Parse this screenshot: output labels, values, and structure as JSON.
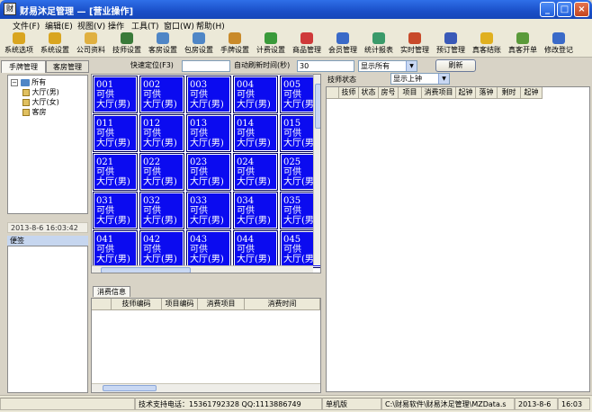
{
  "window": {
    "title": "财易沐足管理 — [营业操作]",
    "buttons": [
      "_",
      "□",
      "×"
    ]
  },
  "menu": [
    "文件(F)",
    "编辑(E)",
    "视图(V)",
    "操作",
    "工具(T)",
    "窗口(W)",
    "帮助(H)"
  ],
  "toolbar": [
    {
      "label": "系统选项",
      "icon": "system-options-icon",
      "color": "#d9a520"
    },
    {
      "label": "系统设置",
      "icon": "system-settings-icon",
      "color": "#d9a520"
    },
    {
      "label": "公司资料",
      "icon": "company-info-icon",
      "color": "#e0b040"
    },
    {
      "label": "技师设置",
      "icon": "technician-settings-icon",
      "color": "#3a7a3a"
    },
    {
      "label": "客房设置",
      "icon": "room-settings-icon",
      "color": "#4f86c6"
    },
    {
      "label": "包房设置",
      "icon": "private-room-settings-icon",
      "color": "#4f86c6"
    },
    {
      "label": "手牌设置",
      "icon": "hand-card-settings-icon",
      "color": "#c98a2a"
    },
    {
      "label": "计费设置",
      "icon": "billing-settings-icon",
      "color": "#3a9a3a"
    },
    {
      "label": "商品管理",
      "icon": "product-management-icon",
      "color": "#cf3a3a"
    },
    {
      "label": "会员管理",
      "icon": "member-management-icon",
      "color": "#3a6ac8"
    },
    {
      "label": "统计报表",
      "icon": "statistics-report-icon",
      "color": "#3a9a6a"
    },
    {
      "label": "实时管理",
      "icon": "realtime-management-icon",
      "color": "#c84a2a"
    },
    {
      "label": "预订管理",
      "icon": "reservation-management-icon",
      "color": "#3a5ab8"
    },
    {
      "label": "真客结账",
      "icon": "checkout-icon",
      "color": "#e0b020"
    },
    {
      "label": "真客开单",
      "icon": "open-order-icon",
      "color": "#5a9a3a"
    },
    {
      "label": "修改登记",
      "icon": "modify-registration-icon",
      "color": "#3a6ac8"
    }
  ],
  "left_panel": {
    "tabs": [
      "手牌管理",
      "客房管理"
    ],
    "tree": {
      "root": "所有",
      "children": [
        "大厅(男)",
        "大厅(女)",
        "客房"
      ]
    },
    "datetime": "2013-8-6  16:03:42",
    "note_label": "便签"
  },
  "center_controls": {
    "quick_locate_label": "快速定位(F3)",
    "quick_locate_value": "",
    "auto_refresh_label": "自动刷新时间(秒)",
    "auto_refresh_value": "30",
    "display_select": "显示所有",
    "refresh_button": "刷新"
  },
  "rooms": [
    {
      "number": "001",
      "status": "可供",
      "type": "大厅(男)"
    },
    {
      "number": "002",
      "status": "可供",
      "type": "大厅(男)"
    },
    {
      "number": "003",
      "status": "可供",
      "type": "大厅(男)"
    },
    {
      "number": "004",
      "status": "可供",
      "type": "大厅(男)"
    },
    {
      "number": "005",
      "status": "可供",
      "type": "大厅(男)"
    },
    {
      "number": "011",
      "status": "可供",
      "type": "大厅(男)"
    },
    {
      "number": "012",
      "status": "可供",
      "type": "大厅(男)"
    },
    {
      "number": "013",
      "status": "可供",
      "type": "大厅(男)"
    },
    {
      "number": "014",
      "status": "可供",
      "type": "大厅(男)"
    },
    {
      "number": "015",
      "status": "可供",
      "type": "大厅(男)"
    },
    {
      "number": "021",
      "status": "可供",
      "type": "大厅(男)"
    },
    {
      "number": "022",
      "status": "可供",
      "type": "大厅(男)"
    },
    {
      "number": "023",
      "status": "可供",
      "type": "大厅(男)"
    },
    {
      "number": "024",
      "status": "可供",
      "type": "大厅(男)"
    },
    {
      "number": "025",
      "status": "可供",
      "type": "大厅(男)"
    },
    {
      "number": "031",
      "status": "可供",
      "type": "大厅(男)"
    },
    {
      "number": "032",
      "status": "可供",
      "type": "大厅(男)"
    },
    {
      "number": "033",
      "status": "可供",
      "type": "大厅(男)"
    },
    {
      "number": "034",
      "status": "可供",
      "type": "大厅(男)"
    },
    {
      "number": "035",
      "status": "可供",
      "type": "大厅(男)"
    },
    {
      "number": "041",
      "status": "可供",
      "type": "大厅(男)"
    },
    {
      "number": "042",
      "status": "可供",
      "type": "大厅(男)"
    },
    {
      "number": "043",
      "status": "可供",
      "type": "大厅(男)"
    },
    {
      "number": "044",
      "status": "可供",
      "type": "大厅(男)"
    },
    {
      "number": "045",
      "status": "可供",
      "type": "大厅(男)"
    }
  ],
  "room_color": "#0b0bf0",
  "consume_panel": {
    "tab": "消费信息",
    "columns": [
      "",
      "技师编码",
      "项目编码",
      "消费项目",
      "消费时间"
    ]
  },
  "tech_panel": {
    "status_label": "技师状态",
    "status_select": "显示上钟",
    "columns": [
      "",
      "技师",
      "状态",
      "房号",
      "项目",
      "消费项目",
      "起钟",
      "落钟",
      "剩时",
      "起钟"
    ]
  },
  "statusbar": {
    "support": "技术支持电话：15361792328 QQ:1113886749",
    "edition": "单机版",
    "path": "C:\\财易软件\\财易沐足管理\\MZData.s",
    "date": "2013-8-6",
    "time": "16:03"
  }
}
